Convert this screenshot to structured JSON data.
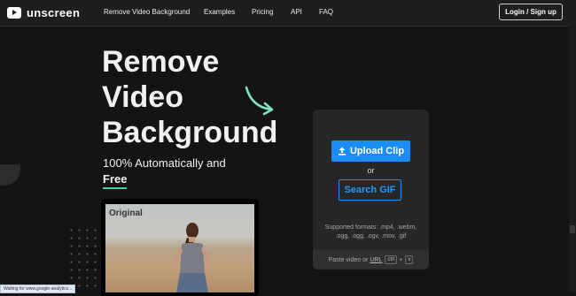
{
  "nav": {
    "logo_text": "unscreen",
    "links": [
      "Remove Video Background",
      "Examples",
      "Pricing",
      "API",
      "FAQ"
    ],
    "login_label": "Login / Sign up"
  },
  "hero": {
    "title_lines": [
      "Remove",
      "Video",
      "Background"
    ],
    "subtitle": "100% Automatically and",
    "highlight": "Free",
    "accent_color": "#3fd3a3"
  },
  "preview": {
    "label": "Original"
  },
  "upload_card": {
    "upload_label": "Upload Clip",
    "upload_icon": "upload-icon",
    "or_text": "or",
    "search_label": "Search GIF",
    "formats_line1": "Supported formats: .mp4, .webm,",
    "formats_line2": ".ogg, .ogg, .ogv, .mov, .gif",
    "paste_prefix": "Paste video or",
    "paste_link": "URL",
    "kbd_ctrl": "ctrl",
    "kbd_plus": "+",
    "kbd_v": "v",
    "button_color": "#1a8ef4"
  },
  "status_bar": {
    "text": "Waiting for www.google-analytics..."
  }
}
